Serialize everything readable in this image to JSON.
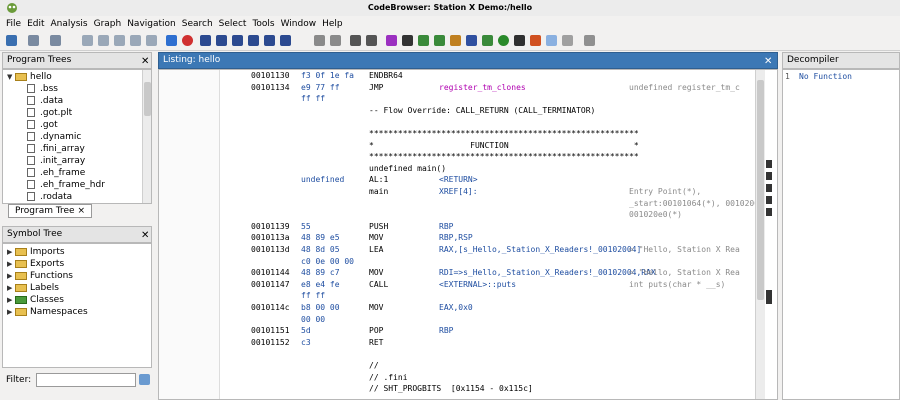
{
  "window": {
    "title": "CodeBrowser: Station X Demo:/hello"
  },
  "menu": [
    "File",
    "Edit",
    "Analysis",
    "Graph",
    "Navigation",
    "Search",
    "Select",
    "Tools",
    "Window",
    "Help"
  ],
  "program_trees": {
    "title": "Program Trees",
    "root": "hello",
    "items": [
      ".bss",
      ".data",
      ".got.plt",
      ".got",
      ".dynamic",
      ".fini_array",
      ".init_array",
      ".eh_frame",
      ".eh_frame_hdr",
      ".rodata"
    ],
    "tab": "Program Tree ×"
  },
  "symbol_tree": {
    "title": "Symbol Tree",
    "items": [
      "Imports",
      "Exports",
      "Functions",
      "Labels",
      "Classes",
      "Namespaces"
    ]
  },
  "filter": {
    "label": "Filter:"
  },
  "listing": {
    "title": "Listing:  hello",
    "lines": [
      {
        "addr": "00101130",
        "bytes": "f3 0f 1e fa",
        "mnem": "ENDBR64",
        "op": "",
        "cmt": ""
      },
      {
        "addr": "00101134",
        "bytes": "e9 77 ff",
        "mnem": "JMP",
        "op": "register_tm_clones",
        "cmt": "undefined register_tm_c"
      },
      {
        "addr": "",
        "bytes": "ff ff",
        "mnem": "",
        "op": "",
        "cmt": ""
      },
      {
        "addr": "",
        "bytes": "",
        "mnem": "-- Flow Override: CALL_RETURN (CALL_TERMINATOR)",
        "op": "",
        "cmt": ""
      },
      {
        "addr": "",
        "bytes": "",
        "mnem": "",
        "op": "",
        "cmt": ""
      },
      {
        "addr": "",
        "bytes": "",
        "mnem": "********************************************************",
        "op": "",
        "cmt": ""
      },
      {
        "addr": "",
        "bytes": "",
        "mnem": "*                    FUNCTION                          *",
        "op": "",
        "cmt": ""
      },
      {
        "addr": "",
        "bytes": "",
        "mnem": "********************************************************",
        "op": "",
        "cmt": ""
      },
      {
        "addr": "",
        "bytes": "",
        "mnem": "undefined main()",
        "op": "",
        "cmt": ""
      },
      {
        "addr": "",
        "bytes": "undefined",
        "mnem": "AL:1",
        "op": "<RETURN>",
        "cmt": ""
      },
      {
        "addr": "",
        "bytes": "",
        "mnem": "main",
        "op": "XREF[4]:",
        "cmt": "Entry Point(*),"
      },
      {
        "addr": "",
        "bytes": "",
        "mnem": "",
        "op": "",
        "cmt": "_start:00101064(*), 0010200"
      },
      {
        "addr": "",
        "bytes": "",
        "mnem": "",
        "op": "",
        "cmt": "001020e0(*)"
      },
      {
        "addr": "00101139",
        "bytes": "55",
        "mnem": "PUSH",
        "op": "RBP",
        "cmt": ""
      },
      {
        "addr": "0010113a",
        "bytes": "48 89 e5",
        "mnem": "MOV",
        "op": "RBP,RSP",
        "cmt": ""
      },
      {
        "addr": "0010113d",
        "bytes": "48 8d 05",
        "mnem": "LEA",
        "op": "RAX,[s_Hello,_Station_X_Readers!_00102004]",
        "cmt": "= \"Hello, Station X Rea"
      },
      {
        "addr": "",
        "bytes": "c0 0e 00 00",
        "mnem": "",
        "op": "",
        "cmt": ""
      },
      {
        "addr": "00101144",
        "bytes": "48 89 c7",
        "mnem": "MOV",
        "op": "RDI=>s_Hello,_Station_X_Readers!_00102004,RAX",
        "cmt": "= \"Hello, Station X Rea"
      },
      {
        "addr": "00101147",
        "bytes": "e8 e4 fe",
        "mnem": "CALL",
        "op": "<EXTERNAL>::puts",
        "cmt": "int puts(char * __s)"
      },
      {
        "addr": "",
        "bytes": "ff ff",
        "mnem": "",
        "op": "",
        "cmt": ""
      },
      {
        "addr": "0010114c",
        "bytes": "b8 00 00",
        "mnem": "MOV",
        "op": "EAX,0x0",
        "cmt": ""
      },
      {
        "addr": "",
        "bytes": "00 00",
        "mnem": "",
        "op": "",
        "cmt": ""
      },
      {
        "addr": "00101151",
        "bytes": "5d",
        "mnem": "POP",
        "op": "RBP",
        "cmt": ""
      },
      {
        "addr": "00101152",
        "bytes": "c3",
        "mnem": "RET",
        "op": "",
        "cmt": ""
      },
      {
        "addr": "",
        "bytes": "",
        "mnem": "",
        "op": "",
        "cmt": ""
      },
      {
        "addr": "",
        "bytes": "",
        "mnem": "//",
        "op": "",
        "cmt": ""
      },
      {
        "addr": "",
        "bytes": "",
        "mnem": "// .fini",
        "op": "",
        "cmt": ""
      },
      {
        "addr": "",
        "bytes": "",
        "mnem": "// SHT_PROGBITS  [0x1154 - 0x115c]",
        "op": "",
        "cmt": ""
      }
    ]
  },
  "decompiler": {
    "title": "Decompiler",
    "line_no": "1",
    "text": "No Function"
  },
  "colors": {
    "accent": "#3c78b5"
  }
}
